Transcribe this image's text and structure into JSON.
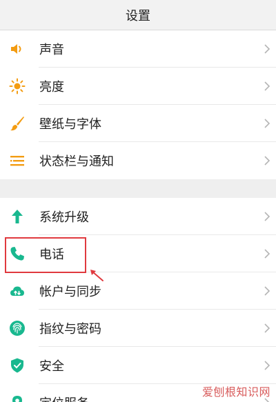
{
  "header": {
    "title": "设置"
  },
  "groups": [
    {
      "items": [
        {
          "label": "声音",
          "icon": "speaker-icon"
        },
        {
          "label": "亮度",
          "icon": "sun-icon"
        },
        {
          "label": "壁纸与字体",
          "icon": "brush-icon"
        },
        {
          "label": "状态栏与通知",
          "icon": "notification-bars-icon"
        }
      ]
    },
    {
      "items": [
        {
          "label": "系统升级",
          "icon": "up-arrow-icon"
        },
        {
          "label": "电话",
          "icon": "phone-icon"
        },
        {
          "label": "帐户与同步",
          "icon": "cloud-sync-icon"
        },
        {
          "label": "指纹与密码",
          "icon": "fingerprint-icon"
        },
        {
          "label": "安全",
          "icon": "shield-icon"
        },
        {
          "label": "定位服务",
          "icon": "location-icon"
        }
      ]
    }
  ],
  "colors": {
    "orange": "#f39c12",
    "teal": "#19b88f",
    "highlight_red": "#e0393e"
  },
  "watermark": {
    "text": "爱刨根知识网"
  }
}
